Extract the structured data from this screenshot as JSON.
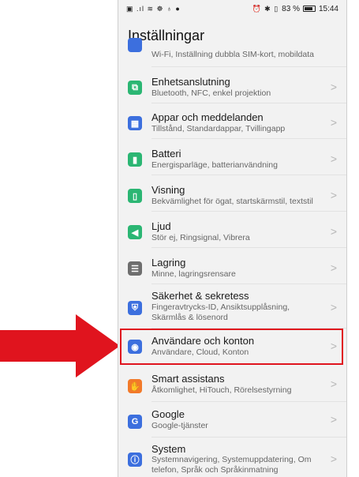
{
  "status_bar": {
    "left_icons": "▣ .ıl ≋ ☸ ♁ ●",
    "right_icons": "⏰ ✱ ▯",
    "battery_text": "83 %",
    "time": "15:44"
  },
  "page_title": "Inställningar",
  "rows": [
    {
      "name": "partial-row",
      "title": "",
      "subtitle": "Wi-Fi, Inställning dubbla SIM-kort, mobildata",
      "icon": "network-icon",
      "icon_color": "#3c6fde"
    },
    {
      "name": "enhetsanslutning",
      "title": "Enhetsanslutning",
      "subtitle": "Bluetooth, NFC, enkel projektion",
      "icon": "device-connection-icon",
      "icon_color": "#2bb673"
    },
    {
      "name": "appar",
      "title": "Appar och meddelanden",
      "subtitle": "Tillstånd, Standardappar, Tvillingapp",
      "icon": "apps-icon",
      "icon_color": "#3c6fde"
    },
    {
      "name": "batteri",
      "title": "Batteri",
      "subtitle": "Energisparläge, batterianvändning",
      "icon": "battery-icon",
      "icon_color": "#2bb673"
    },
    {
      "name": "visning",
      "title": "Visning",
      "subtitle": "Bekvämlighet för ögat, startskärmstil, textstil",
      "icon": "display-icon",
      "icon_color": "#2bb673"
    },
    {
      "name": "ljud",
      "title": "Ljud",
      "subtitle": "Stör ej, Ringsignal, Vibrera",
      "icon": "sound-icon",
      "icon_color": "#2bb673"
    },
    {
      "name": "lagring",
      "title": "Lagring",
      "subtitle": "Minne, lagringsrensare",
      "icon": "storage-icon",
      "icon_color": "#6e6e6e"
    },
    {
      "name": "sakerhet",
      "title": "Säkerhet & sekretess",
      "subtitle": "Fingeravtrycks-ID, Ansiktsupplåsning, Skärmlås & lösenord",
      "icon": "shield-icon",
      "icon_color": "#3c6fde"
    },
    {
      "name": "anvandare",
      "title": "Användare och konton",
      "subtitle": "Användare, Cloud, Konton",
      "icon": "user-icon",
      "icon_color": "#3c6fde"
    },
    {
      "name": "smart-assistans",
      "title": "Smart assistans",
      "subtitle": "Åtkomlighet, HiTouch, Rörelsestyrning",
      "icon": "hand-icon",
      "icon_color": "#f27a2a"
    },
    {
      "name": "google",
      "title": "Google",
      "subtitle": "Google-tjänster",
      "icon": "google-icon",
      "icon_color": "#3c6fde"
    },
    {
      "name": "system",
      "title": "System",
      "subtitle": "Systemnavigering, Systemuppdatering, Om telefon, Språk och Språkinmatning",
      "icon": "system-icon",
      "icon_color": "#3c6fde"
    }
  ],
  "highlight_color": "#e0141e",
  "arrow_color": "#e0141e"
}
